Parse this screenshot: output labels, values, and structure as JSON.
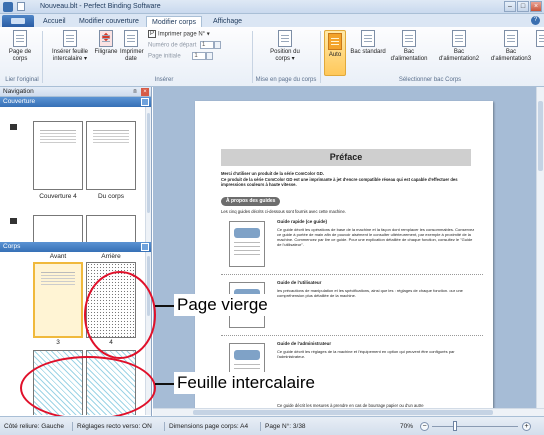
{
  "window": {
    "title": "Nouveau.blt - Perfect Binding Software"
  },
  "tabs": [
    "Accueil",
    "Modifier couverture",
    "Modifier corps",
    "Affichage"
  ],
  "ribbon": {
    "page_de_corps": "Page de corps",
    "inserer_feuille": "Insérer feuille intercalaire",
    "filigrane": "Filigrane",
    "imprimer_date": "Imprimer date",
    "group_ligne": "Lier l'original",
    "group_inserer": "Insérer",
    "imprimer_page_no": "Imprimer page N°",
    "numero_depart_label": "Numéro de départ",
    "numero_depart_value": "1",
    "page_initiale_label": "Page initiale",
    "page_initiale_value": "1",
    "position_du_corps": "Position du corps",
    "group_mise_en_page": "Mise en page du corps",
    "auto": "Auto",
    "bac_std": "Bac standard",
    "bac_alim": "Bac d'alimentation",
    "bac_alim2": "Bac d'alimentation2",
    "bac_alim3": "Bac d'alimentation3",
    "bac_supp": "Bac supplém",
    "group_bac": "Sélectionner bac Corps"
  },
  "nav": {
    "title": "Navigation",
    "pin": "ᴨ",
    "couverture": "Couverture",
    "couverture_caption_left": "Couverture 4",
    "couverture_caption_right": "Du corps",
    "corps": "Corps",
    "col_avant": "Avant",
    "col_arriere": "Arrière",
    "page_3": "3",
    "page_4": "4"
  },
  "document": {
    "heading": "Préface",
    "intro_1": "Merci d'utiliser un produit de la série ComColor GD.",
    "intro_2": "Ce produit de la série ComColor GD est une imprimante à jet d'encre compatible réseau qui est capable d'effectuer des impressions couleurs à haute vitesse.",
    "section": "À propos des guides",
    "section_intro": "Les cinq guides décrits ci-dessous sont fournis avec cette machine.",
    "guide1_title": "Guide rapide (ce guide)",
    "guide1_desc": "Ce guide décrit les opérations de base de la machine et la façon dont remplacer les consommables. Conservez ce guide à portée de main afin de pouvoir aisément le consulter ultérieurement, par exemple à proximité de la machine. Commencez par lire ce guide. Pour une explication détaillée de chaque fonction, consultez le \"Guide de l'utilisateur\".",
    "guide2_title": "Guide de l'utilisateur",
    "guide2_desc": "les précautions de manipulation et les spécifications, ainsi que les : réglages de chaque fonction. our une compréhension plus détaillée de la machine.",
    "guide3_title": "Guide de l'administrateur",
    "guide3_desc": "Ce guide décrit les réglages de la machine et l'équipement en option qui peuvent être configurés par l'administrateur.",
    "guide4_desc": "Ce guide décrit les mesures à prendre en cas de bourrage papier ou d'un autre"
  },
  "callouts": {
    "page_vierge": "Page vierge",
    "feuille_intercalaire": "Feuille intercalaire"
  },
  "status": {
    "cote_reliure": "Côté reliure: Gauche",
    "reglages_recto_verso": "Réglages recto verso: ON",
    "dimensions": "Dimensions page corps: A4",
    "page_no": "Page N°: 3/38",
    "zoom": "70%"
  },
  "colors": {
    "accent": "#3670b6",
    "callout_ring": "#e0102a",
    "hatch": "#9dd4e6",
    "doc_background": "#a6bcd6"
  }
}
